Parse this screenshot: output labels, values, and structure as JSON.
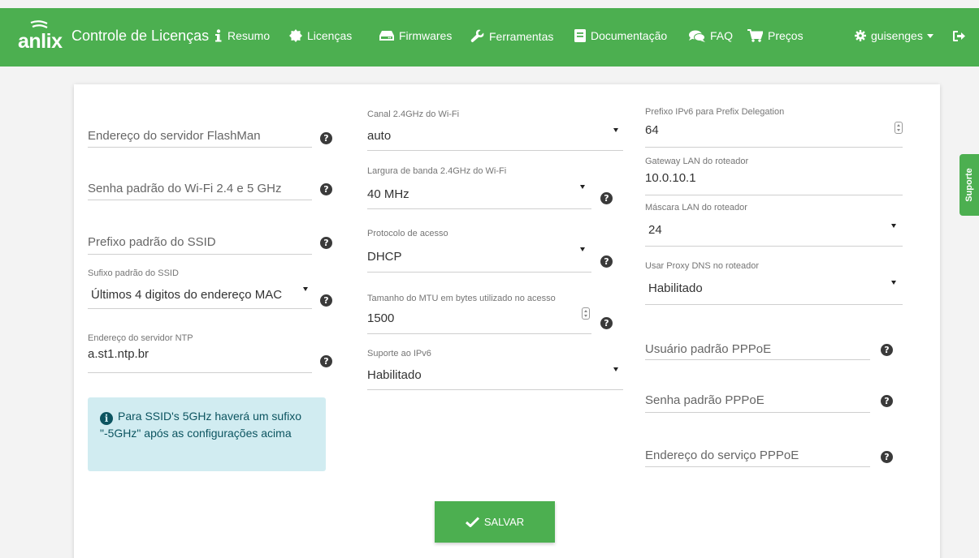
{
  "navbar": {
    "logo_text": "anlix",
    "brand": "Controle de Licenças",
    "items": [
      {
        "label": "Resumo",
        "icon": "info-icon"
      },
      {
        "label": "Licenças",
        "icon": "certificate-icon"
      },
      {
        "label": "Firmwares",
        "icon": "hdd-icon"
      },
      {
        "label": "Ferramentas",
        "icon": "wrench-icon"
      },
      {
        "label": "Documentação",
        "icon": "book-icon"
      },
      {
        "label": "FAQ",
        "icon": "comments-icon"
      },
      {
        "label": "Preços",
        "icon": "cart-icon"
      }
    ],
    "user": {
      "label": "guisenges",
      "icon": "gear-icon"
    },
    "logout_icon": "sign-out-icon"
  },
  "form": {
    "col1": {
      "flashman_server": {
        "placeholder": "Endereço do servidor FlashMan"
      },
      "wifi_password": {
        "placeholder": "Senha padrão do Wi-Fi 2.4 e 5 GHz"
      },
      "ssid_prefix": {
        "placeholder": "Prefixo padrão do SSID"
      },
      "ssid_suffix": {
        "label": "Sufixo padrão do SSID",
        "value": "Últimos 4 digitos do endereço MAC"
      },
      "ntp_server": {
        "label": "Endereço do servidor NTP",
        "value": "a.st1.ntp.br"
      }
    },
    "col2": {
      "wifi_channel": {
        "label": "Canal 2.4GHz do Wi-Fi",
        "value": "auto"
      },
      "wifi_bandwidth": {
        "label": "Largura de banda 2.4GHz do Wi-Fi",
        "value": "40 MHz"
      },
      "access_protocol": {
        "label": "Protocolo de acesso",
        "value": "DHCP"
      },
      "mtu": {
        "label": "Tamanho do MTU em bytes utilizado no acesso",
        "value": "1500"
      },
      "ipv6_support": {
        "label": "Suporte ao IPv6",
        "value": "Habilitado"
      }
    },
    "col3": {
      "ipv6_prefix": {
        "label": "Prefixo IPv6 para Prefix Delegation",
        "value": "64"
      },
      "lan_gateway": {
        "label": "Gateway LAN do roteador",
        "value": "10.0.10.1"
      },
      "lan_mask": {
        "label": "Máscara LAN do roteador",
        "value": "24"
      },
      "dns_proxy": {
        "label": "Usar Proxy DNS no roteador",
        "value": "Habilitado"
      },
      "pppoe_user": {
        "placeholder": "Usuário padrão PPPoE"
      },
      "pppoe_password": {
        "placeholder": "Senha padrão PPPoE"
      },
      "pppoe_service": {
        "placeholder": "Endereço do serviço PPPoE"
      }
    },
    "alert": {
      "text": "Para SSID's 5GHz haverá um sufixo \"-5GHz\" após as configurações acima"
    },
    "save_label": "SALVAR"
  },
  "support_tab": "Suporte",
  "colors": {
    "brand": "#4caf50",
    "alert_bg": "#d1ecf1",
    "alert_text": "#0c5460"
  }
}
